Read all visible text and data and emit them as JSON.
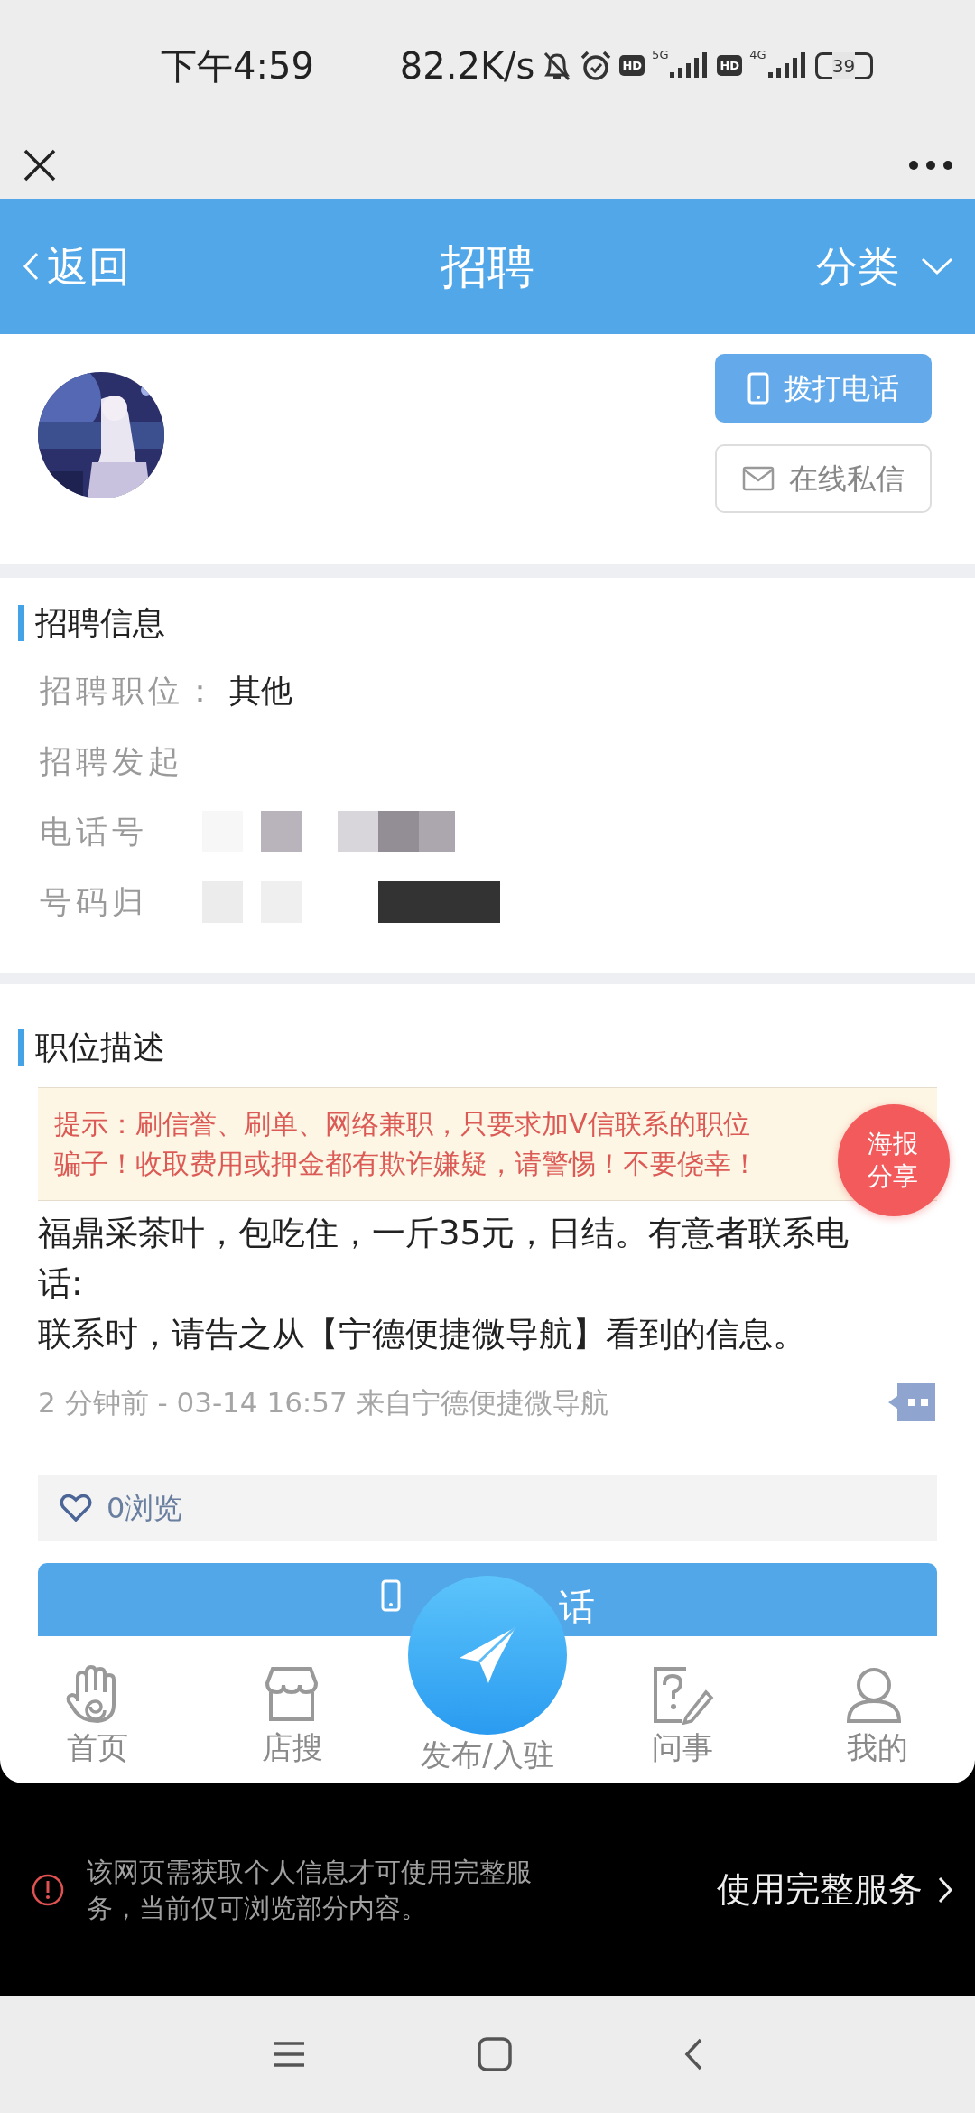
{
  "status_bar": {
    "time": "下午4:59",
    "speed": "82.2K/s",
    "sims": [
      {
        "badge": "HD",
        "network": "5G"
      },
      {
        "badge": "HD",
        "network": "4G"
      }
    ],
    "battery": "39"
  },
  "header": {
    "back": "返回",
    "title": "招聘",
    "category": "分类"
  },
  "profile": {
    "call_button": "拨打电话",
    "message_button": "在线私信"
  },
  "info": {
    "title": "招聘信息",
    "rows": [
      {
        "label": "招聘职位：",
        "value": "其他",
        "redacted": false
      },
      {
        "label": "招聘发起",
        "redacted": false
      },
      {
        "label": "电话号",
        "redacted": true
      },
      {
        "label": "号码归",
        "redacted": true
      }
    ]
  },
  "description": {
    "title": "职位描述",
    "warning_lines": [
      "提示：刷信誉、刷单、网络兼职，只要求加V信联系的职位",
      "骗子！收取费用或押金都有欺诈嫌疑，请警惕！不要侥幸！"
    ],
    "share_badge": "海报分享",
    "paragraphs": [
      "福鼎采茶叶，包吃住，一斤35元，日结。有意者联系电话:",
      "联系时，请告之从【宁德便捷微导航】看到的信息。"
    ],
    "meta": "2 分钟前 - 03-14 16:57 来自宁德便捷微导航",
    "views": "0浏览",
    "call_button": "话"
  },
  "bottom_nav": {
    "items": [
      {
        "label": "首页",
        "kind": "hand"
      },
      {
        "label": "店搜",
        "kind": "shop"
      },
      {
        "label": "发布/入驻",
        "kind": "publish"
      },
      {
        "label": "问事",
        "kind": "question"
      },
      {
        "label": "我的",
        "kind": "user"
      }
    ]
  },
  "permission_banner": {
    "message": "该网页需获取个人信息才可使用完整服务，当前仅可浏览部分内容。",
    "action": "使用完整服务"
  }
}
